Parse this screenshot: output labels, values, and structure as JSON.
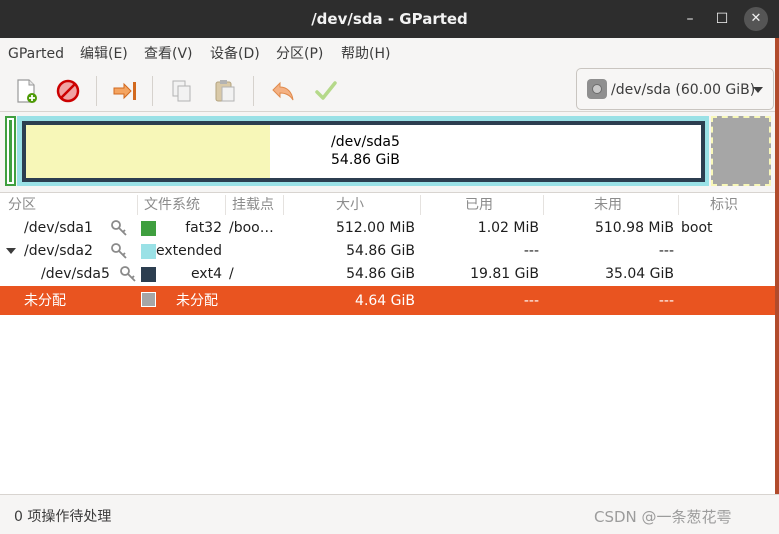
{
  "window": {
    "title": "/dev/sda - GParted",
    "min_glyph": "–",
    "max_glyph": "☐",
    "close_glyph": "✕"
  },
  "menu": {
    "items": [
      "GParted",
      "编辑(E)",
      "查看(V)",
      "设备(D)",
      "分区(P)",
      "帮助(H)"
    ]
  },
  "toolbar": {
    "icons": [
      "new-partition-icon",
      "delete-partition-icon",
      "resize-move-icon",
      "copy-icon",
      "paste-icon",
      "undo-icon",
      "apply-icon"
    ]
  },
  "device_selector": {
    "label": "/dev/sda (60.00 GiB)",
    "icon": "hard-disk-icon"
  },
  "visualization": {
    "partition_name": "/dev/sda5",
    "partition_size": "54.86 GiB",
    "used_fraction": 0.361
  },
  "table": {
    "headers": [
      "分区",
      "文件系统",
      "挂载点",
      "大小",
      "已用",
      "未用",
      "标识"
    ],
    "rows": [
      {
        "partition": "/dev/sda1",
        "fs": "fat32",
        "mount": "/boo…",
        "size": "512.00 MiB",
        "used": "1.02 MiB",
        "unused": "510.98 MiB",
        "flags": "boot"
      },
      {
        "partition": "/dev/sda2",
        "fs": "extended",
        "mount": "",
        "size": "54.86 GiB",
        "used": "---",
        "unused": "---",
        "flags": ""
      },
      {
        "partition": "/dev/sda5",
        "fs": "ext4",
        "mount": "/",
        "size": "54.86 GiB",
        "used": "19.81 GiB",
        "unused": "35.04 GiB",
        "flags": ""
      },
      {
        "partition": "未分配",
        "fs": "未分配",
        "mount": "",
        "size": "4.64 GiB",
        "used": "---",
        "unused": "---",
        "flags": ""
      }
    ]
  },
  "colors": {
    "fat32": "#3f9f3f",
    "extended": "#9ae1e6",
    "ext4": "#2c3e50",
    "unallocated": "#a6a6a6",
    "selection": "#e95420"
  },
  "status": {
    "pending": "0 项操作待处理",
    "watermark": "CSDN @一条葱花雩"
  }
}
